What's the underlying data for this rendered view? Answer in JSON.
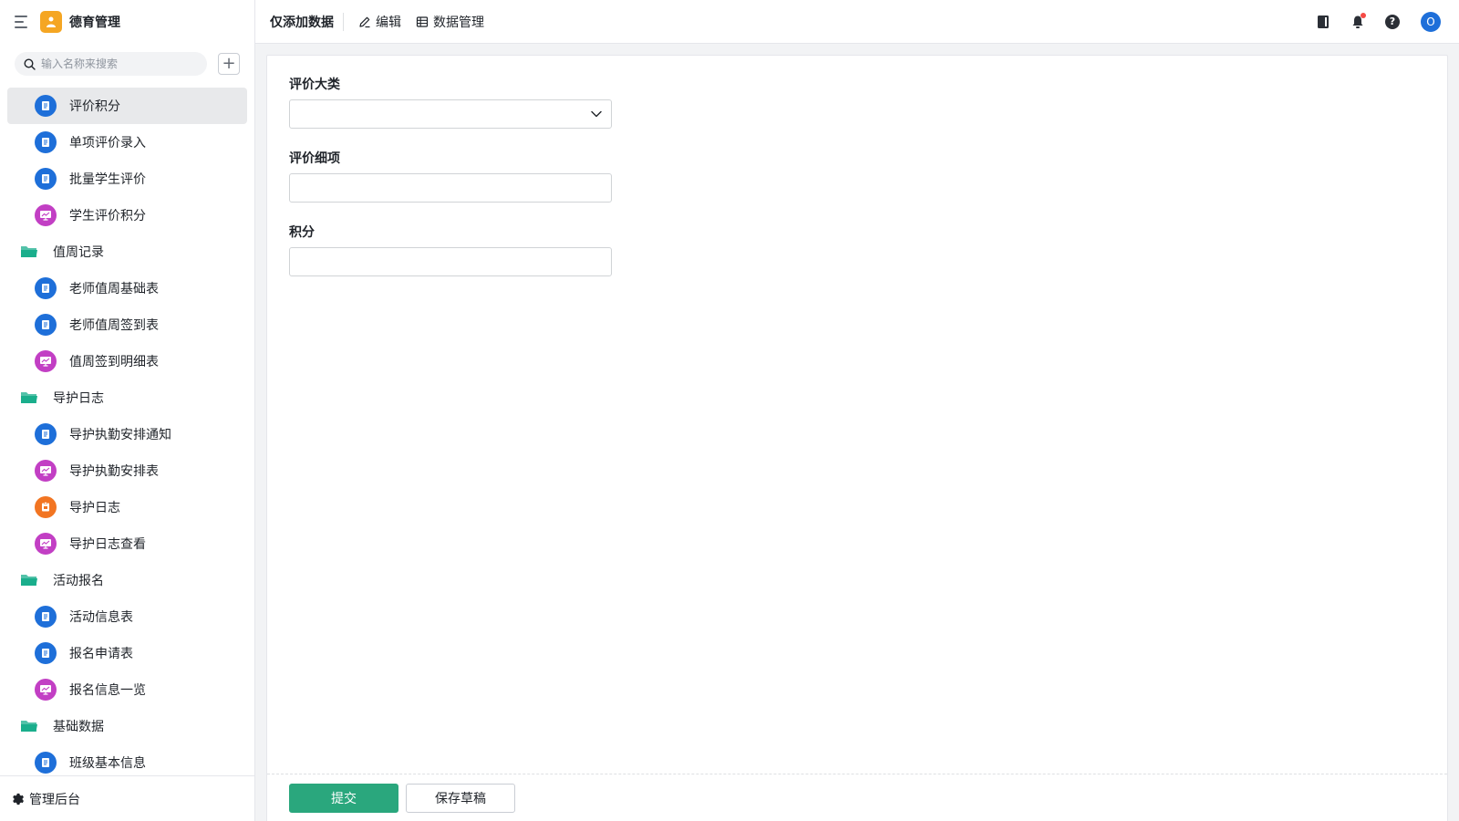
{
  "app": {
    "title": "德育管理"
  },
  "search": {
    "placeholder": "输入名称来搜索"
  },
  "sidebar": {
    "items": [
      {
        "type": "leaf",
        "label": "评价积分",
        "icon": "form-icon",
        "color": "blue",
        "active": true
      },
      {
        "type": "leaf",
        "label": "单项评价录入",
        "icon": "form-icon",
        "color": "blue"
      },
      {
        "type": "leaf",
        "label": "批量学生评价",
        "icon": "form-icon",
        "color": "blue"
      },
      {
        "type": "leaf",
        "label": "学生评价积分",
        "icon": "report-icon",
        "color": "purple"
      },
      {
        "type": "folder",
        "label": "值周记录",
        "icon": "folder-icon"
      },
      {
        "type": "leaf",
        "label": "老师值周基础表",
        "icon": "form-icon",
        "color": "blue"
      },
      {
        "type": "leaf",
        "label": "老师值周签到表",
        "icon": "form-icon",
        "color": "blue"
      },
      {
        "type": "leaf",
        "label": "值周签到明细表",
        "icon": "report-icon",
        "color": "purple"
      },
      {
        "type": "folder",
        "label": "导护日志",
        "icon": "folder-icon"
      },
      {
        "type": "leaf",
        "label": "导护执勤安排通知",
        "icon": "form-icon",
        "color": "blue"
      },
      {
        "type": "leaf",
        "label": "导护执勤安排表",
        "icon": "report-icon",
        "color": "purple"
      },
      {
        "type": "leaf",
        "label": "导护日志",
        "icon": "flow-icon",
        "color": "orange"
      },
      {
        "type": "leaf",
        "label": "导护日志查看",
        "icon": "report-icon",
        "color": "purple"
      },
      {
        "type": "folder",
        "label": "活动报名",
        "icon": "folder-icon"
      },
      {
        "type": "leaf",
        "label": "活动信息表",
        "icon": "form-icon",
        "color": "blue"
      },
      {
        "type": "leaf",
        "label": "报名申请表",
        "icon": "form-icon",
        "color": "blue"
      },
      {
        "type": "leaf",
        "label": "报名信息一览",
        "icon": "report-icon",
        "color": "purple"
      },
      {
        "type": "folder",
        "label": "基础数据",
        "icon": "folder-icon"
      },
      {
        "type": "leaf",
        "label": "班级基本信息",
        "icon": "form-icon",
        "color": "blue"
      }
    ],
    "footer_label": "管理后台"
  },
  "topbar": {
    "title": "仅添加数据",
    "edit_label": "编辑",
    "data_manage_label": "数据管理",
    "avatar_letter": "O"
  },
  "form": {
    "fields": [
      {
        "label": "评价大类",
        "type": "select",
        "value": ""
      },
      {
        "label": "评价细项",
        "type": "text",
        "value": ""
      },
      {
        "label": "积分",
        "type": "text",
        "value": ""
      }
    ],
    "submit_label": "提交",
    "draft_label": "保存草稿"
  },
  "colors": {
    "blue": "#1e6fd9",
    "purple": "#c23fc4",
    "orange": "#f27522",
    "folder": "#1aae8c",
    "submit": "#2aa77d",
    "app_logo": "#f5a623"
  }
}
